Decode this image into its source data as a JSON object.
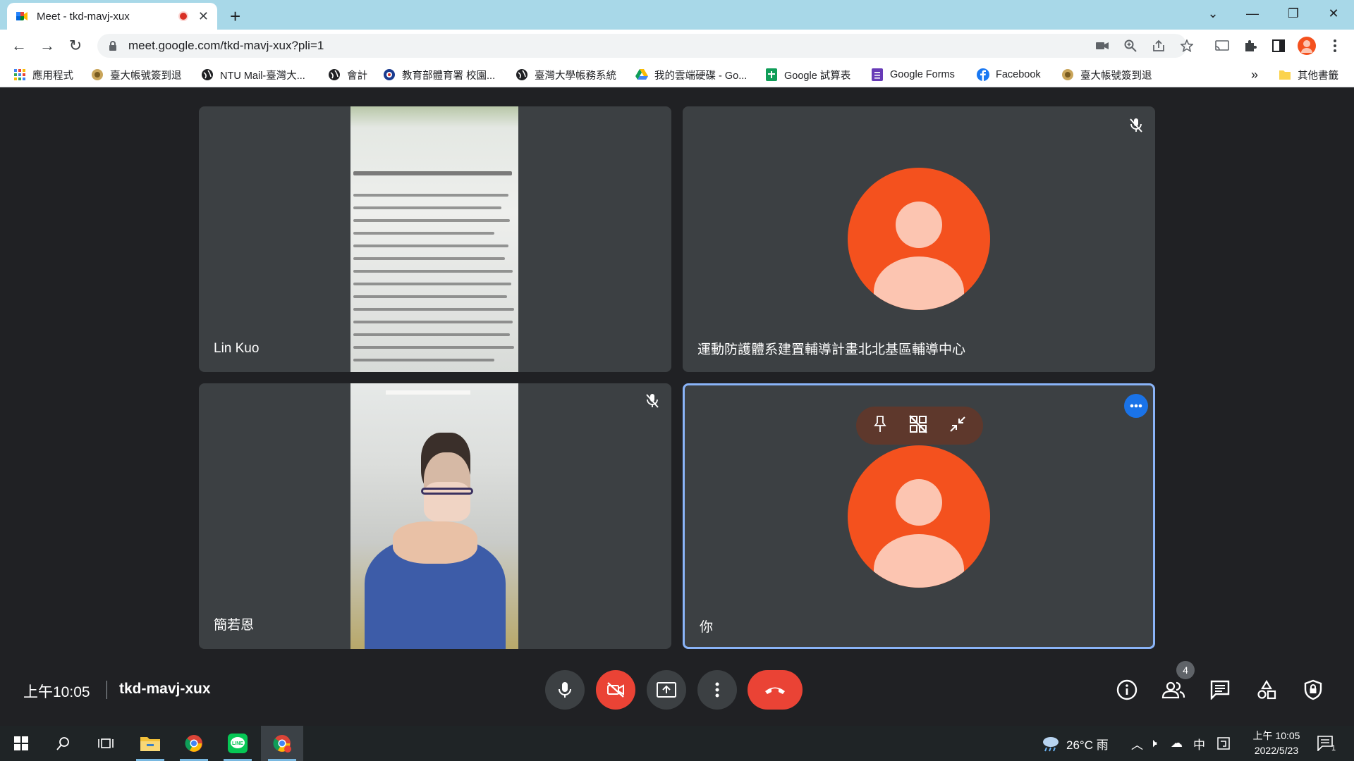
{
  "browser": {
    "tab_title": "Meet - tkd-mavj-xux",
    "url": "meet.google.com/tkd-mavj-xux?pli=1"
  },
  "bookmarks": [
    {
      "label": "應用程式",
      "icon": "apps-grid-icon"
    },
    {
      "label": "臺大帳號簽到退",
      "icon": "ntu-seal-icon"
    },
    {
      "label": "NTU Mail-臺灣大...",
      "icon": "globe-icon"
    },
    {
      "label": "會計",
      "icon": "globe-icon"
    },
    {
      "label": "教育部體育署 校園...",
      "icon": "moe-seal-icon"
    },
    {
      "label": "臺灣大學帳務系統",
      "icon": "globe-icon"
    },
    {
      "label": "我的雲端硬碟 - Go...",
      "icon": "drive-icon"
    },
    {
      "label": "Google 試算表",
      "icon": "sheets-icon"
    },
    {
      "label": "Google Forms",
      "icon": "forms-icon"
    },
    {
      "label": "Facebook",
      "icon": "facebook-icon"
    },
    {
      "label": "臺大帳號簽到退",
      "icon": "ntu-seal-icon"
    }
  ],
  "bookmarks_more": "»",
  "other_bookmarks": "其他書籤",
  "participants": [
    {
      "name": "Lin Kuo",
      "muted": false,
      "video": "document"
    },
    {
      "name": "運動防護體系建置輔導計畫北北基區輔導中心",
      "muted": true,
      "video": "avatar"
    },
    {
      "name": "簡若恩",
      "muted": true,
      "video": "camera"
    },
    {
      "name": "你",
      "muted": false,
      "video": "avatar",
      "self": true
    }
  ],
  "meeting": {
    "time": "上午10:05",
    "code": "tkd-mavj-xux",
    "participant_count": "4"
  },
  "taskbar": {
    "weather": "26°C 雨",
    "ime": "中",
    "time": "上午 10:05",
    "date": "2022/5/23",
    "notification_count": "1"
  },
  "colors": {
    "avatar": "#f4511e",
    "avatar_figure": "#fcc5b1",
    "tile_bg": "#3c4043",
    "stage_bg": "#202124",
    "end_call": "#ea4335",
    "self_border": "#8ab4f8",
    "tabstrip": "#a8d8e8"
  }
}
